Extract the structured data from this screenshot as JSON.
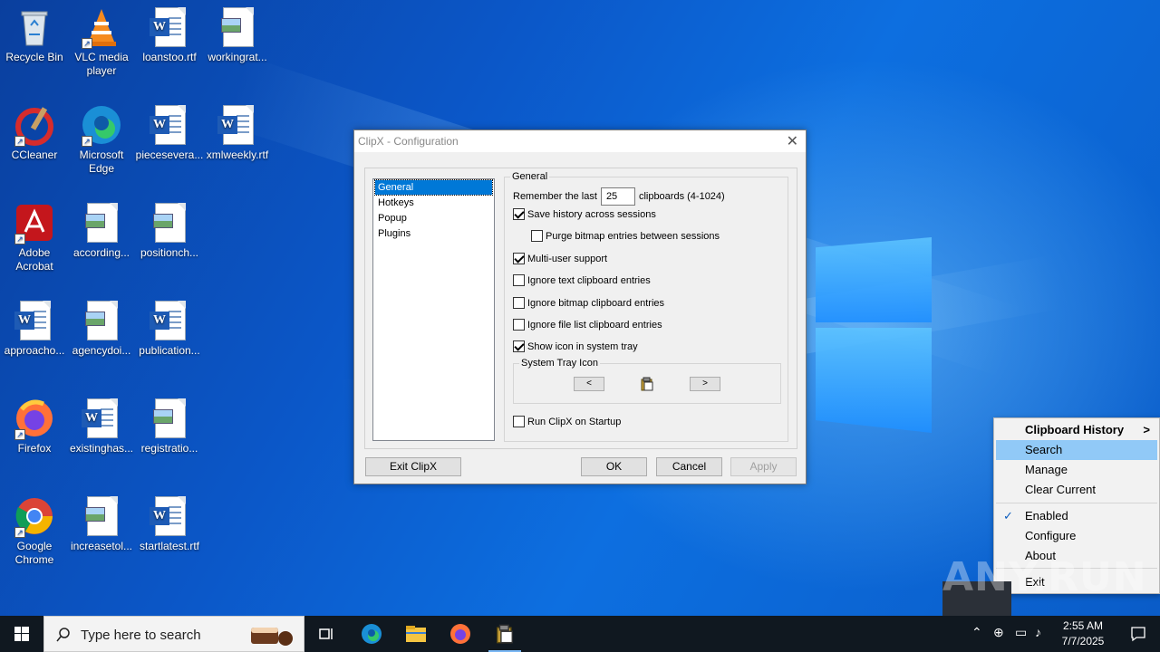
{
  "desktop": {
    "icons": [
      {
        "label": "Recycle Bin",
        "icon": "recycle-bin-icon"
      },
      {
        "label": "VLC media player",
        "icon": "vlc-icon"
      },
      {
        "label": "loanstoo.rtf",
        "icon": "word-doc-icon"
      },
      {
        "label": "workingrat...",
        "icon": "image-doc-icon"
      },
      {
        "label": "CCleaner",
        "icon": "ccleaner-icon"
      },
      {
        "label": "Microsoft Edge",
        "icon": "edge-icon"
      },
      {
        "label": "piecesevera...",
        "icon": "word-doc-icon"
      },
      {
        "label": "xmlweekly.rtf",
        "icon": "word-doc-icon"
      },
      {
        "label": "Adobe Acrobat",
        "icon": "acrobat-icon"
      },
      {
        "label": "according...",
        "icon": "image-doc-icon"
      },
      {
        "label": "positionch...",
        "icon": "image-doc-icon"
      },
      {
        "label": "approacho...",
        "icon": "word-doc-icon"
      },
      {
        "label": "agencydoi...",
        "icon": "image-doc-icon"
      },
      {
        "label": "publication...",
        "icon": "word-doc-icon"
      },
      {
        "label": "Firefox",
        "icon": "firefox-icon"
      },
      {
        "label": "existinghas...",
        "icon": "word-doc-icon"
      },
      {
        "label": "registratio...",
        "icon": "image-doc-icon"
      },
      {
        "label": "Google Chrome",
        "icon": "chrome-icon"
      },
      {
        "label": "increasetol...",
        "icon": "image-doc-icon"
      },
      {
        "label": "startlatest.rtf",
        "icon": "word-doc-icon"
      }
    ]
  },
  "dialog": {
    "title": "ClipX - Configuration",
    "nav": [
      "General",
      "Hotkeys",
      "Popup",
      "Plugins"
    ],
    "selected_nav": "General",
    "general_legend": "General",
    "remember_prefix": "Remember the last",
    "remember_value": "25",
    "remember_suffix": "clipboards (4-1024)",
    "options": [
      {
        "label": "Save history across sessions",
        "checked": true
      },
      {
        "label": "Purge bitmap entries between sessions",
        "checked": false
      },
      {
        "label": "Multi-user support",
        "checked": true
      },
      {
        "label": "Ignore text clipboard entries",
        "checked": false
      },
      {
        "label": "Ignore bitmap clipboard entries",
        "checked": false
      },
      {
        "label": "Ignore file list clipboard entries",
        "checked": false
      },
      {
        "label": "Show icon in system tray",
        "checked": true
      },
      {
        "label": "Run ClipX on Startup",
        "checked": false
      }
    ],
    "tray_legend": "System Tray Icon",
    "prev_symbol": "<",
    "next_symbol": ">",
    "buttons": {
      "exit": "Exit ClipX",
      "ok": "OK",
      "cancel": "Cancel",
      "apply": "Apply"
    }
  },
  "context_menu": {
    "items": [
      {
        "label": "Clipboard History",
        "bold": true,
        "submenu": true
      },
      {
        "label": "Search",
        "highlighted": true
      },
      {
        "label": "Manage"
      },
      {
        "label": "Clear Current"
      },
      {
        "label": "Enabled",
        "checked": true
      },
      {
        "label": "Configure"
      },
      {
        "label": "About"
      },
      {
        "label": "Exit"
      }
    ],
    "chevron": ">",
    "check_mark": "✓"
  },
  "watermark": "ANY.RUN",
  "taskbar": {
    "search_placeholder": "Type here to search",
    "time": "2:55 AM",
    "date": "7/7/2025",
    "accent": "#0078d7"
  }
}
